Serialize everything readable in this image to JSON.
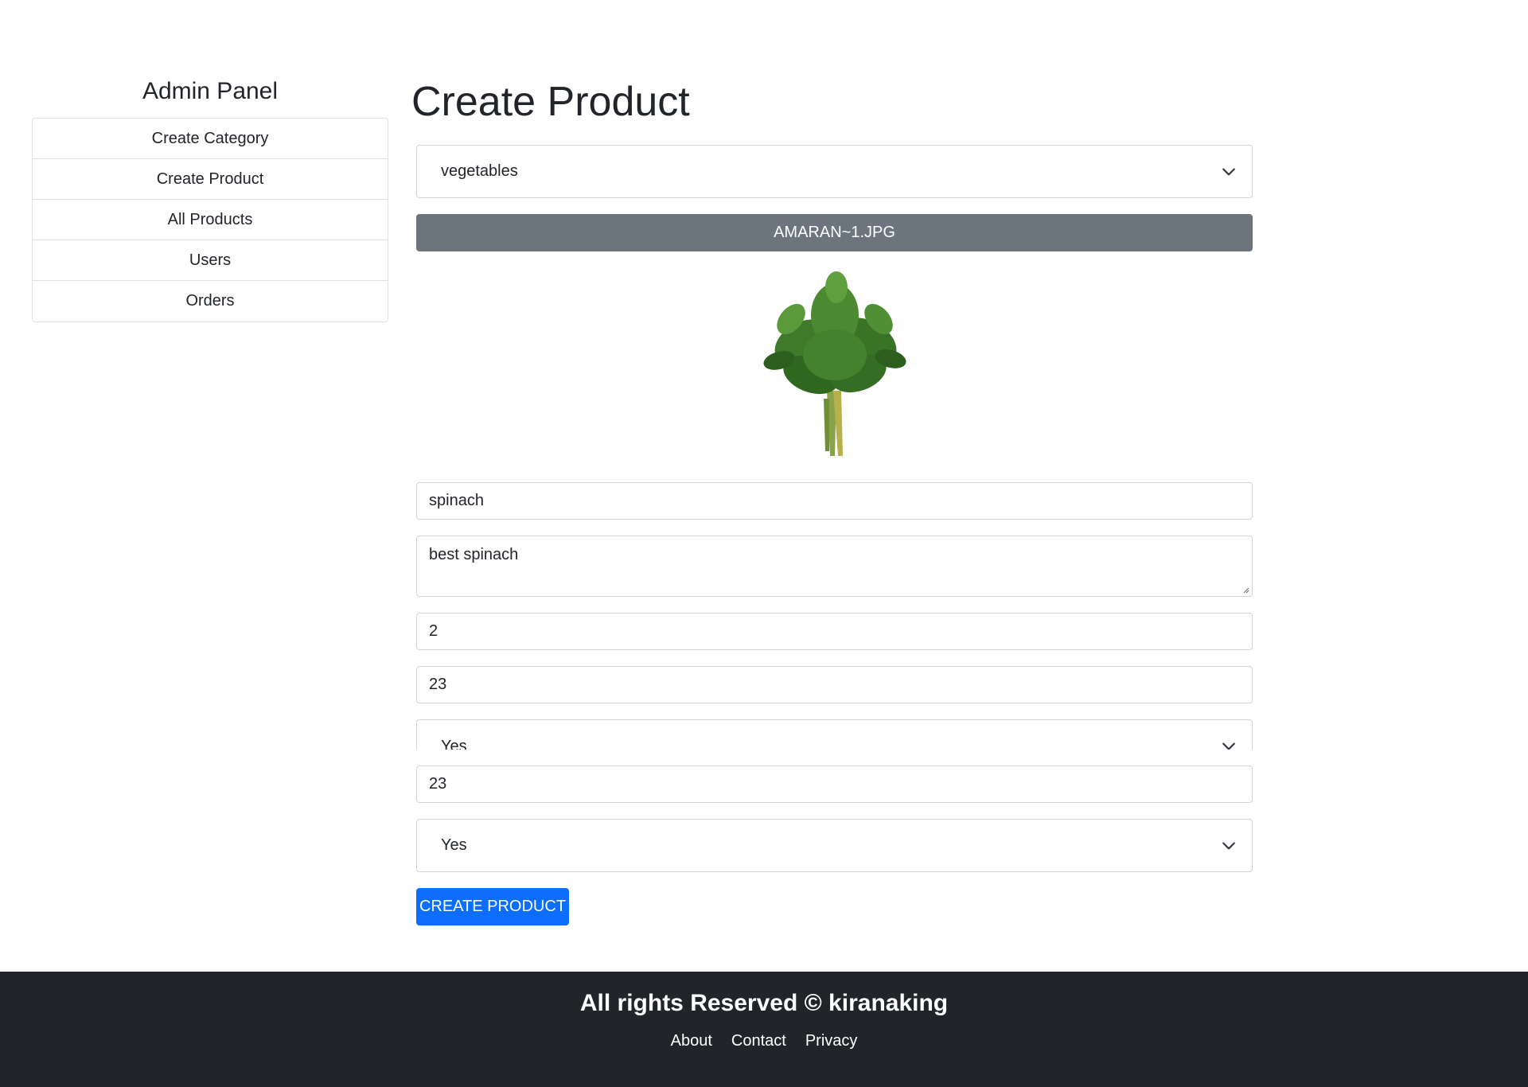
{
  "sidebar": {
    "title": "Admin Panel",
    "items": [
      {
        "label": "Create Category"
      },
      {
        "label": "Create Product"
      },
      {
        "label": "All Products"
      },
      {
        "label": "Users"
      },
      {
        "label": "Orders"
      }
    ]
  },
  "main": {
    "title": "Create Product",
    "category_select": {
      "value": "vegetables"
    },
    "upload_button": {
      "label": "AMARAN~1.JPG"
    },
    "preview_image": {
      "icon": "spinach-image"
    },
    "name_input": {
      "value": "spinach"
    },
    "description_input": {
      "value": "best spinach"
    },
    "price_input": {
      "value": "2"
    },
    "quantity_input": {
      "value": "23"
    },
    "shipping_select_overlapped": {
      "value": "Yes"
    },
    "quantity_input_2": {
      "value": "23"
    },
    "shipping_select": {
      "value": "Yes"
    },
    "submit_button": {
      "label": "CREATE PRODUCT"
    }
  },
  "footer": {
    "text": "All rights Reserved © kiranaking",
    "links": [
      {
        "label": "About"
      },
      {
        "label": "Contact"
      },
      {
        "label": "Privacy"
      }
    ]
  },
  "colors": {
    "primary": "#0d6efd",
    "secondary": "#6c757d",
    "footer_bg": "#212529"
  }
}
